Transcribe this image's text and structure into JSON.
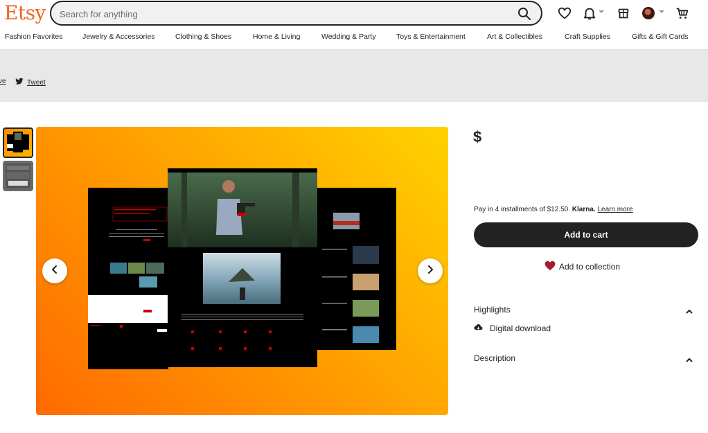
{
  "header": {
    "logo": "Etsy",
    "search_placeholder": "Search for anything",
    "icons": [
      "search-icon",
      "heart-icon",
      "bell-icon",
      "gift-icon",
      "avatar",
      "cart-icon"
    ]
  },
  "nav": {
    "items": [
      "Fashion Favorites",
      "Jewelry & Accessories",
      "Clothing & Shoes",
      "Home & Living",
      "Wedding & Party",
      "Toys & Entertainment",
      "Art & Collectibles",
      "Craft Supplies",
      "Gifts & Gift Cards"
    ]
  },
  "share": {
    "save_label": "ve",
    "tweet_label": "Tweet"
  },
  "listing": {
    "price": "$",
    "installments_text": "Pay in 4 installments of $12.50.",
    "klarna": "Klarna.",
    "learn_more": "Learn more",
    "add_to_cart": "Add to cart",
    "add_to_collection": "Add to collection",
    "highlights_label": "Highlights",
    "digital_download": "Digital download",
    "description_label": "Description"
  },
  "mockup": {
    "center_heading": "Cinematic Productions",
    "left_heading": "Capture the Magic",
    "left_subheading": "Adventure Abroad Collection",
    "right_heading": "Be Inspired"
  },
  "colors": {
    "brand": "#f1641e",
    "button_dark": "#222222",
    "hero_gradient_start": "#ff6a00",
    "hero_gradient_end": "#ffd200",
    "heart": "#a61a2e"
  }
}
